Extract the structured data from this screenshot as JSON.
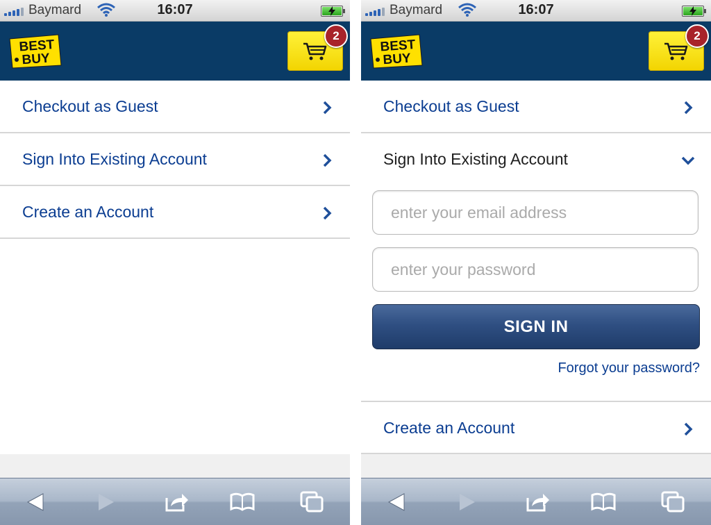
{
  "status_bar": {
    "carrier": "Baymard",
    "time": "16:07",
    "signal_icon": "signal-bars-icon",
    "wifi_icon": "wifi-icon",
    "battery_icon": "battery-charging-icon"
  },
  "header": {
    "logo_text_line1": "BEST",
    "logo_text_line2": "BUY",
    "cart_icon": "shopping-cart-icon",
    "cart_count": "2"
  },
  "left": {
    "menu": [
      {
        "label": "Checkout as Guest",
        "icon": "chevron-right-icon"
      },
      {
        "label": "Sign Into Existing Account",
        "icon": "chevron-right-icon"
      },
      {
        "label": "Create an Account",
        "icon": "chevron-right-icon"
      }
    ]
  },
  "right": {
    "menu_top": [
      {
        "label": "Checkout as Guest",
        "icon": "chevron-right-icon"
      },
      {
        "label": "Sign Into Existing Account",
        "icon": "chevron-down-icon"
      }
    ],
    "form": {
      "email_placeholder": "enter your email address",
      "password_placeholder": "enter your password",
      "email_value": "",
      "password_value": "",
      "sign_in_label": "SIGN IN",
      "forgot_label": "Forgot your password?"
    },
    "menu_bottom": [
      {
        "label": "Create an Account",
        "icon": "chevron-right-icon"
      }
    ]
  },
  "toolbar": {
    "icons": [
      "back-arrow-icon",
      "forward-arrow-icon",
      "share-icon",
      "bookmarks-icon",
      "tabs-icon"
    ]
  },
  "colors": {
    "header_bg": "#0a3b66",
    "link_blue": "#0b3d91",
    "cart_yellow": "#fff23a",
    "badge_red": "#a8232a",
    "button_navy": "#2f4f82"
  }
}
